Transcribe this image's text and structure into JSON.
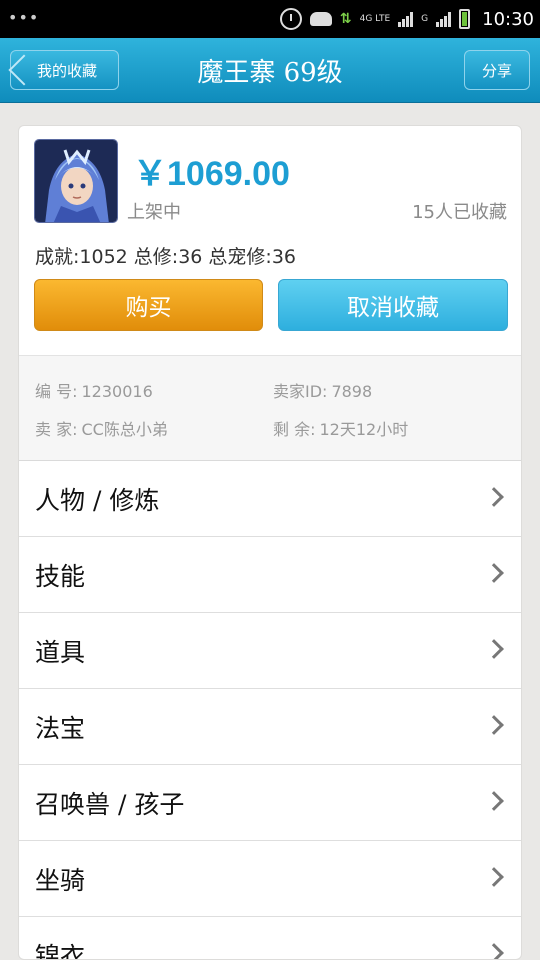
{
  "status_bar": {
    "net_top": "4G LTE",
    "net_bottom": "G",
    "time": "10:30"
  },
  "header": {
    "back_label": "我的收藏",
    "title": "魔王寨 69级",
    "share_label": "分享"
  },
  "item": {
    "price": "￥1069.00",
    "status": "上架中",
    "fav_count": "15人已收藏",
    "stats": "成就:1052 总修:36 总宠修:36",
    "buy_label": "购买",
    "cancel_fav_label": "取消收藏"
  },
  "info": {
    "id_label": "编 号:",
    "id_value": "1230016",
    "seller_id_label": "卖家ID:",
    "seller_id_value": "7898",
    "seller_label": "卖 家:",
    "seller_value": "CC陈总小弟",
    "remaining_label": "剩 余:",
    "remaining_value": "12天12小时"
  },
  "menu": [
    {
      "label": "人物 / 修炼"
    },
    {
      "label": "技能"
    },
    {
      "label": "道具"
    },
    {
      "label": "法宝"
    },
    {
      "label": "召唤兽 / 孩子"
    },
    {
      "label": "坐骑"
    },
    {
      "label": "锦衣"
    }
  ],
  "colors": {
    "header": "#1a9cca",
    "price": "#1d9ed3",
    "buy": "#f0a21c",
    "cancel": "#45c0e8"
  }
}
